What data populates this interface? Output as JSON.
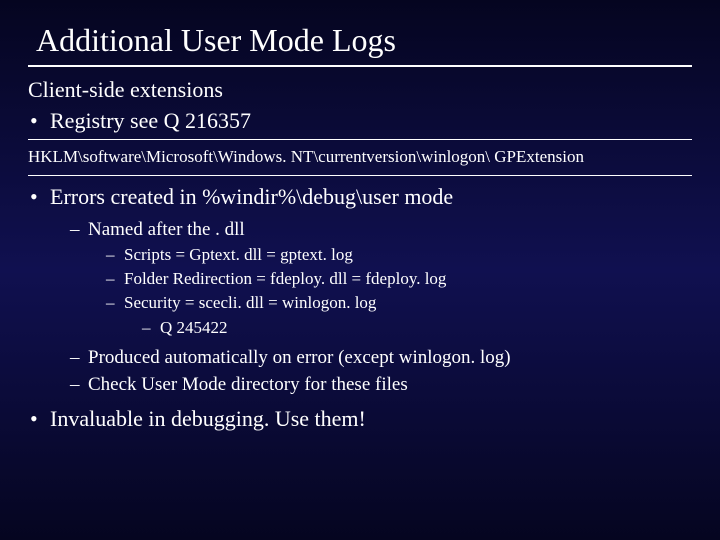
{
  "slide": {
    "title": "Additional User Mode Logs",
    "line1": "Client-side extensions",
    "b1": "Registry see Q 216357",
    "regpath": "HKLM\\software\\Microsoft\\Windows. NT\\currentversion\\winlogon\\ GPExtension",
    "b2": "Errors created in %windir%\\debug\\user mode",
    "b2_1": "Named after the . dll",
    "b2_1_1": "Scripts = Gptext. dll = gptext. log",
    "b2_1_2": "Folder Redirection = fdeploy. dll = fdeploy. log",
    "b2_1_3": "Security = scecli. dll = winlogon. log",
    "b2_1_3_1": "Q 245422",
    "b2_2": "Produced automatically on error (except winlogon. log)",
    "b2_3": "Check User Mode directory for these files",
    "b3": "Invaluable in debugging. Use them!"
  }
}
